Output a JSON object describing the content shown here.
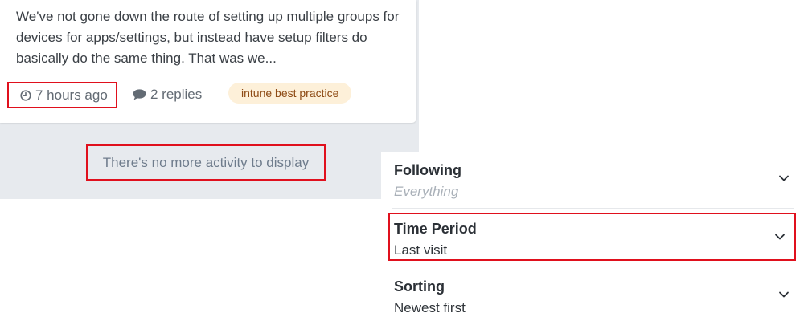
{
  "activity": {
    "excerpt": "We've not gone down the route of setting up multiple groups for devices for apps/settings, but instead have setup filters do basically do the same thing. That was we...",
    "time_ago": "7 hours ago",
    "replies": "2 replies",
    "tag": "intune best practice",
    "end_message": "There's no more activity to display",
    "icons": {
      "time": "clock-icon",
      "replies": "comment-icon"
    }
  },
  "filters": [
    {
      "title": "Following",
      "value": "Everything",
      "value_style": "placeholder"
    },
    {
      "title": "Time Period",
      "value": "Last visit",
      "value_style": "normal"
    },
    {
      "title": "Sorting",
      "value": "Newest first",
      "value_style": "normal"
    }
  ],
  "colors": {
    "highlight_border": "#e0101d",
    "tag_bg": "#fdf0d9",
    "tag_text": "#8d4a14",
    "feed_bg": "#e7eaee"
  }
}
